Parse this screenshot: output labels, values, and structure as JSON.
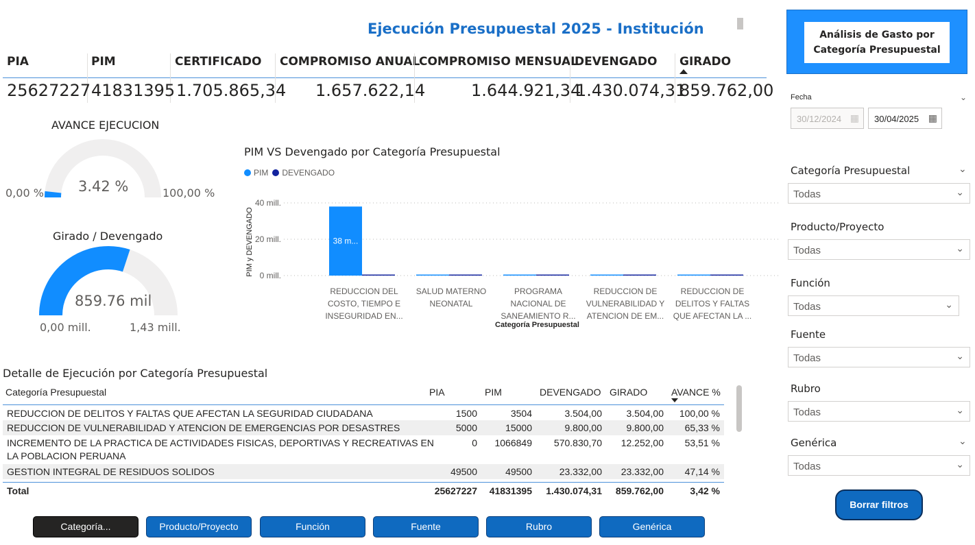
{
  "header": {
    "title": "Ejecución Presupuestal 2025 - Institución"
  },
  "kpis": [
    {
      "label": "PIA",
      "value": "25627227"
    },
    {
      "label": "PIM",
      "value": "41831395"
    },
    {
      "label": "CERTIFICADO",
      "value": "1.705.865,34"
    },
    {
      "label": "COMPROMISO ANUAL",
      "value": "1.657.622,14"
    },
    {
      "label": "COMPROMISO MENSUAL",
      "value": "1.644.921,34"
    },
    {
      "label": "DEVENGADO",
      "value": "1.430.074,31"
    },
    {
      "label": "GIRADO",
      "value": "859.762,00"
    }
  ],
  "gauges": {
    "avance": {
      "title": "AVANCE EJECUCION",
      "value_label": "3.42 %",
      "min_label": "0,00 %",
      "max_label": "100,00 %",
      "fraction": 0.0342,
      "color": "#118dff"
    },
    "girado": {
      "title": "Girado / Devengado",
      "value_label": "859.76 mil",
      "min_label": "0,00 mill.",
      "max_label": "1,43 mill.",
      "fraction": 0.6012,
      "color": "#118dff"
    }
  },
  "chart": {
    "title": "PIM VS Devengado por Categoría Presupuestal",
    "legend": [
      "PIM",
      "DEVENGADO"
    ],
    "ylabel": "PIM y DEVENGADO",
    "xlabel": "Categoría Presupuestal",
    "bar_label": "38 m...",
    "category_labels": [
      "REDUCCION DEL COSTO, TIEMPO E INSEGURIDAD EN...",
      "SALUD MATERNO NEONATAL",
      "PROGRAMA NACIONAL DE SANEAMIENTO R...",
      "REDUCCION DE VULNERABILIDAD Y ATENCION DE EM...",
      "REDUCCION DE DELITOS Y FALTAS QUE AFECTAN LA ..."
    ],
    "tick_labels": [
      "0 mill.",
      "20 mill.",
      "40 mill."
    ]
  },
  "chart_data": {
    "type": "bar",
    "title": "PIM VS Devengado por Categoría Presupuestal",
    "xlabel": "Categoría Presupuestal",
    "ylabel": "PIM y DEVENGADO",
    "categories": [
      "REDUCCION DEL COSTO, TIEMPO E INSEGURIDAD EN...",
      "SALUD MATERNO NEONATAL",
      "PROGRAMA NACIONAL DE SANEAMIENTO R...",
      "REDUCCION DE VULNERABILIDAD Y ATENCION DE EM...",
      "REDUCCION DE DELITOS Y FALTAS QUE AFECTAN LA ..."
    ],
    "series": [
      {
        "name": "PIM",
        "color": "#118dff",
        "values": [
          38000000,
          150000,
          100000,
          15000,
          3504
        ]
      },
      {
        "name": "DEVENGADO",
        "color": "#12239e",
        "values": [
          400000,
          50000,
          30000,
          9800,
          3504
        ]
      }
    ],
    "ylim": [
      0,
      40000000
    ],
    "yticks": [
      0,
      20000000,
      40000000
    ],
    "grid": true,
    "legend": "top-left"
  },
  "table": {
    "title": "Detalle de Ejecución por Categoría Presupuestal",
    "columns": [
      "Categoría Presupuestal",
      "PIA",
      "PIM",
      "DEVENGADO",
      "GIRADO",
      "AVANCE %"
    ],
    "rows": [
      {
        "cat": "REDUCCION DE DELITOS Y FALTAS QUE AFECTAN LA SEGURIDAD CIUDADANA",
        "cat2": "",
        "pia": "1500",
        "pim": "3504",
        "dev": "3.504,00",
        "gir": "3.504,00",
        "av": "100,00 %"
      },
      {
        "cat": "REDUCCION DE VULNERABILIDAD Y ATENCION DE EMERGENCIAS POR DESASTRES",
        "cat2": "",
        "pia": "5000",
        "pim": "15000",
        "dev": "9.800,00",
        "gir": "9.800,00",
        "av": "65,33 %"
      },
      {
        "cat": "INCREMENTO DE LA PRACTICA DE ACTIVIDADES FISICAS, DEPORTIVAS Y RECREATIVAS EN",
        "cat2": "LA POBLACION PERUANA",
        "pia": "0",
        "pim": "1066849",
        "dev": "570.830,70",
        "gir": "12.252,00",
        "av": "53,51 %"
      },
      {
        "cat": "GESTION INTEGRAL DE RESIDUOS SOLIDOS",
        "cat2": "",
        "pia": "49500",
        "pim": "49500",
        "dev": "23.332,00",
        "gir": "23.332,00",
        "av": "47,14 %"
      }
    ],
    "total": {
      "label": "Total",
      "pia": "25627227",
      "pim": "41831395",
      "dev": "1.430.074,31",
      "gir": "859.762,00",
      "av": "3,42 %"
    }
  },
  "nav": [
    "Categoría...",
    "Producto/Proyecto",
    "Función",
    "Fuente",
    "Rubro",
    "Genérica"
  ],
  "panel": {
    "title_line1": "Análisis de Gasto por",
    "title_line2": "Categoría Presupuestal",
    "fecha_label": "Fecha",
    "date_from": "30/12/2024",
    "date_to": "30/04/2025",
    "slicers": [
      {
        "label": "Categoría Presupuestal",
        "value": "Todas"
      },
      {
        "label": "Producto/Proyecto",
        "value": "Todas"
      },
      {
        "label": "Función",
        "value": "Todas"
      },
      {
        "label": "Fuente",
        "value": "Todas"
      },
      {
        "label": "Rubro",
        "value": "Todas"
      },
      {
        "label": "Genérica",
        "value": "Todas"
      }
    ],
    "clear_label": "Borrar filtros"
  }
}
